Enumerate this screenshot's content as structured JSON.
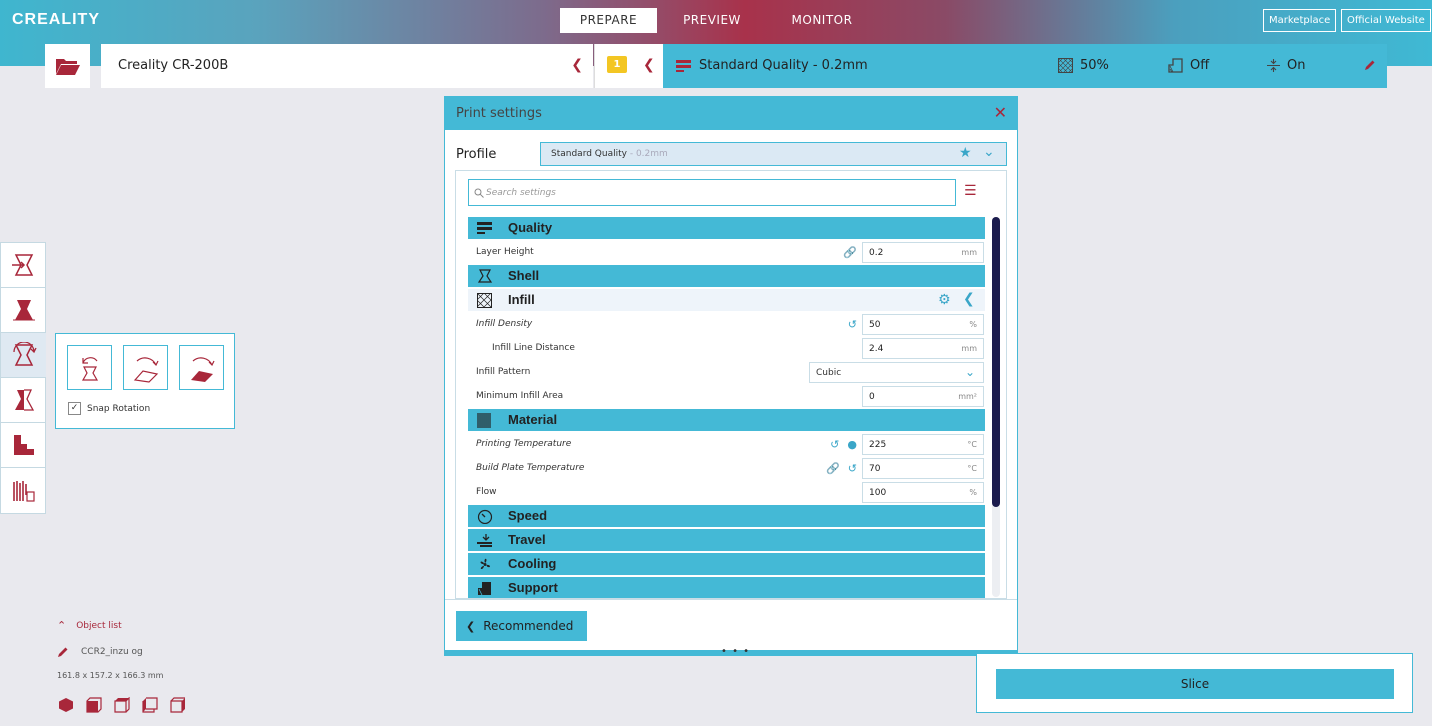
{
  "header": {
    "logo": "CREALITY",
    "tabs": [
      {
        "label": "PREPARE",
        "active": true
      },
      {
        "label": "PREVIEW",
        "active": false
      },
      {
        "label": "MONITOR",
        "active": false
      }
    ],
    "marketplace_label": "Marketplace",
    "website_label": "Official Website"
  },
  "toolbar": {
    "printer_name": "Creality CR-200B",
    "warning_count": "1",
    "quality_label": "Standard Quality - 0.2mm",
    "infill_value": "50%",
    "support_value": "Off",
    "adhesion_value": "On"
  },
  "rotate_panel": {
    "snap_rotation_label": "Snap Rotation",
    "snap_checked": true
  },
  "object_list": {
    "title": "Object list",
    "file_name": "CCR2_inzu og",
    "dimensions": "161.8 x 157.2 x 166.3 mm"
  },
  "print_settings": {
    "title": "Print settings",
    "profile_label": "Profile",
    "profile_value": "Standard Quality",
    "profile_sub": " - 0.2mm",
    "search_placeholder": "Search settings",
    "categories": {
      "quality": "Quality",
      "shell": "Shell",
      "infill": "Infill",
      "material": "Material",
      "speed": "Speed",
      "travel": "Travel",
      "cooling": "Cooling",
      "support": "Support"
    },
    "settings": {
      "layer_height": {
        "label": "Layer Height",
        "value": "0.2",
        "unit": "mm"
      },
      "infill_density": {
        "label": "Infill Density",
        "value": "50",
        "unit": "%"
      },
      "infill_line_distance": {
        "label": "Infill Line Distance",
        "value": "2.4",
        "unit": "mm"
      },
      "infill_pattern": {
        "label": "Infill Pattern",
        "value": "Cubic"
      },
      "min_infill_area": {
        "label": "Minimum Infill Area",
        "value": "0",
        "unit": "mm²"
      },
      "printing_temperature": {
        "label": "Printing Temperature",
        "value": "225",
        "unit": "°C"
      },
      "build_plate_temperature": {
        "label": "Build Plate Temperature",
        "value": "70",
        "unit": "°C"
      },
      "flow": {
        "label": "Flow",
        "value": "100",
        "unit": "%"
      }
    },
    "recommended_label": "Recommended",
    "dots": "• • •"
  },
  "slice": {
    "label": "Slice"
  },
  "colors": {
    "accent": "#44b9d6",
    "brand": "#a8273a",
    "warning": "#f3c623"
  }
}
